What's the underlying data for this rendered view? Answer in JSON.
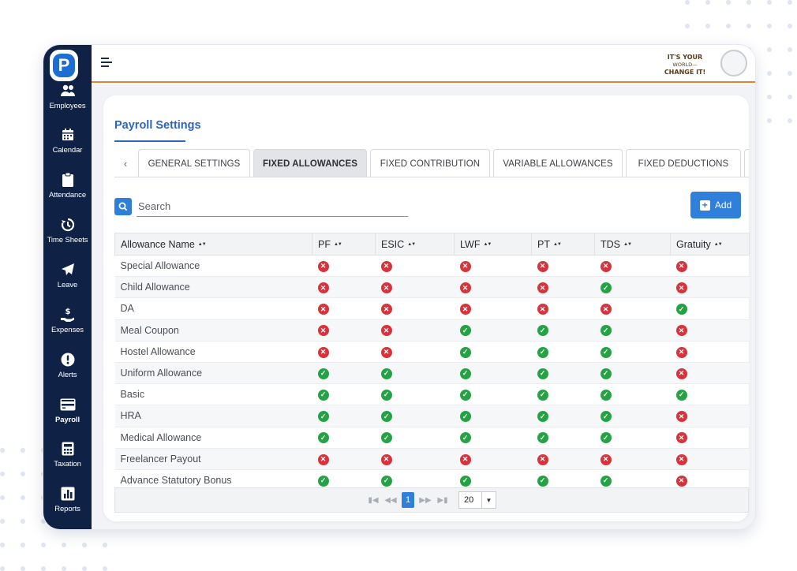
{
  "sidebar": {
    "items": [
      {
        "label": "Employees",
        "icon": "users-icon"
      },
      {
        "label": "Calendar",
        "icon": "calendar-icon"
      },
      {
        "label": "Attendance",
        "icon": "clipboard-icon"
      },
      {
        "label": "Time Sheets",
        "icon": "history-icon"
      },
      {
        "label": "Leave",
        "icon": "paper-plane-icon"
      },
      {
        "label": "Expenses",
        "icon": "hand-dollar-icon"
      },
      {
        "label": "Alerts",
        "icon": "exclamation-icon"
      },
      {
        "label": "Payroll",
        "icon": "credit-card-icon",
        "active": true
      },
      {
        "label": "Taxation",
        "icon": "calculator-icon"
      },
      {
        "label": "Reports",
        "icon": "bar-chart-icon"
      }
    ]
  },
  "header": {
    "brand_line1": "IT'S YOUR",
    "brand_line2": "WORLD—",
    "brand_line3": "CHANGE IT!",
    "accent_color": "#e9822b"
  },
  "page": {
    "title": "Payroll Settings"
  },
  "tabs": {
    "items": [
      {
        "label": "GENERAL SETTINGS"
      },
      {
        "label": "FIXED ALLOWANCES",
        "active": true
      },
      {
        "label": "FIXED CONTRIBUTION"
      },
      {
        "label": "VARIABLE ALLOWANCES"
      },
      {
        "label": "FIXED DEDUCTIONS"
      }
    ]
  },
  "search": {
    "placeholder": "Search"
  },
  "toolbar": {
    "add_label": "Add"
  },
  "table": {
    "columns": [
      "Allowance Name",
      "PF",
      "ESIC",
      "LWF",
      "PT",
      "TDS",
      "Gratuity"
    ],
    "rows": [
      {
        "name": "Special Allowance",
        "flags": [
          false,
          false,
          false,
          false,
          false,
          false
        ]
      },
      {
        "name": "Child Allowance",
        "flags": [
          false,
          false,
          false,
          false,
          true,
          false
        ]
      },
      {
        "name": "DA",
        "flags": [
          false,
          false,
          false,
          false,
          false,
          true
        ]
      },
      {
        "name": "Meal Coupon",
        "flags": [
          false,
          false,
          true,
          true,
          true,
          false
        ]
      },
      {
        "name": "Hostel Allowance",
        "flags": [
          false,
          false,
          true,
          true,
          true,
          false
        ]
      },
      {
        "name": "Uniform Allowance",
        "flags": [
          true,
          true,
          true,
          true,
          true,
          false
        ]
      },
      {
        "name": "Basic",
        "flags": [
          true,
          true,
          true,
          true,
          true,
          true
        ]
      },
      {
        "name": "HRA",
        "flags": [
          true,
          true,
          true,
          true,
          true,
          false
        ]
      },
      {
        "name": "Medical Allowance",
        "flags": [
          true,
          true,
          true,
          true,
          true,
          false
        ]
      },
      {
        "name": "Freelancer Payout",
        "flags": [
          false,
          false,
          false,
          false,
          false,
          false
        ]
      },
      {
        "name": "Advance Statutory Bonus",
        "flags": [
          true,
          true,
          true,
          true,
          true,
          false
        ]
      }
    ],
    "status_colors": {
      "yes": "#24a244",
      "no": "#d8333b"
    }
  },
  "pager": {
    "current_page": "1",
    "page_size": "20"
  }
}
